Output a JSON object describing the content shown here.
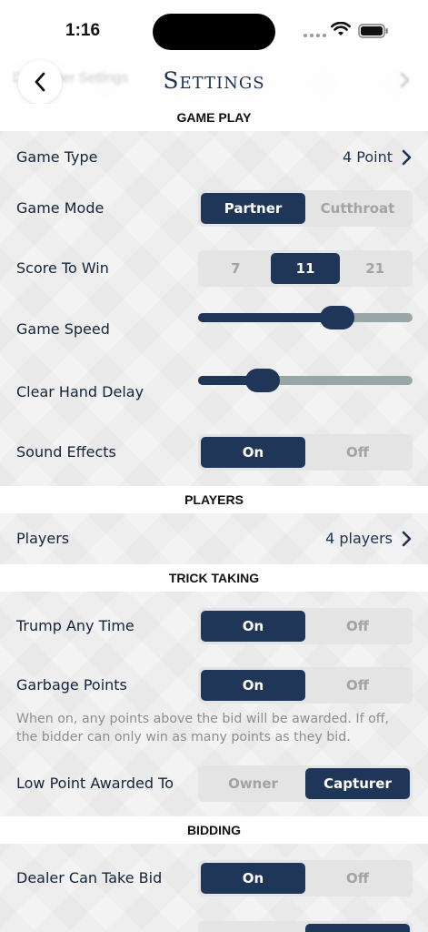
{
  "status_bar": {
    "time": "1:16"
  },
  "nav": {
    "title": "Settings",
    "ghost_title": "Developer Settings"
  },
  "sections": {
    "game_play": "GAME PLAY",
    "players": "PLAYERS",
    "trick_taking": "TRICK TAKING",
    "bidding": "BIDDING"
  },
  "game_type": {
    "label": "Game Type",
    "value": "4 Point"
  },
  "game_mode": {
    "label": "Game Mode",
    "options": [
      "Partner",
      "Cutthroat"
    ],
    "selected": "Partner"
  },
  "score_to_win": {
    "label": "Score To Win",
    "options": [
      "7",
      "11",
      "21"
    ],
    "selected": "11"
  },
  "game_speed": {
    "label": "Game Speed",
    "value_fraction": 0.65
  },
  "clear_hand_delay": {
    "label": "Clear Hand Delay",
    "value_fraction": 0.3
  },
  "sound_effects": {
    "label": "Sound Effects",
    "options": [
      "On",
      "Off"
    ],
    "selected": "On"
  },
  "players": {
    "label": "Players",
    "value": "4 players"
  },
  "trump_any_time": {
    "label": "Trump Any Time",
    "options": [
      "On",
      "Off"
    ],
    "selected": "On"
  },
  "garbage_points": {
    "label": "Garbage Points",
    "options": [
      "On",
      "Off"
    ],
    "selected": "On",
    "help": "When on, any points above the bid will be awarded. If off, the bidder can only win as many points as they bid."
  },
  "low_point_awarded_to": {
    "label": "Low Point Awarded To",
    "options": [
      "Owner",
      "Capturer"
    ],
    "selected": "Capturer"
  },
  "dealer_can_take_bid": {
    "label": "Dealer Can Take Bid",
    "options": [
      "On",
      "Off"
    ],
    "selected": "On"
  },
  "colors": {
    "accent": "#1f3658",
    "segment_bg": "#e4e4e4",
    "slider_track": "#98a6a6",
    "muted_text": "#8e8e8e"
  },
  "icons": {
    "back": "chevron-left-icon",
    "disclosure": "chevron-right-icon",
    "wifi": "wifi-icon",
    "battery": "battery-icon"
  }
}
